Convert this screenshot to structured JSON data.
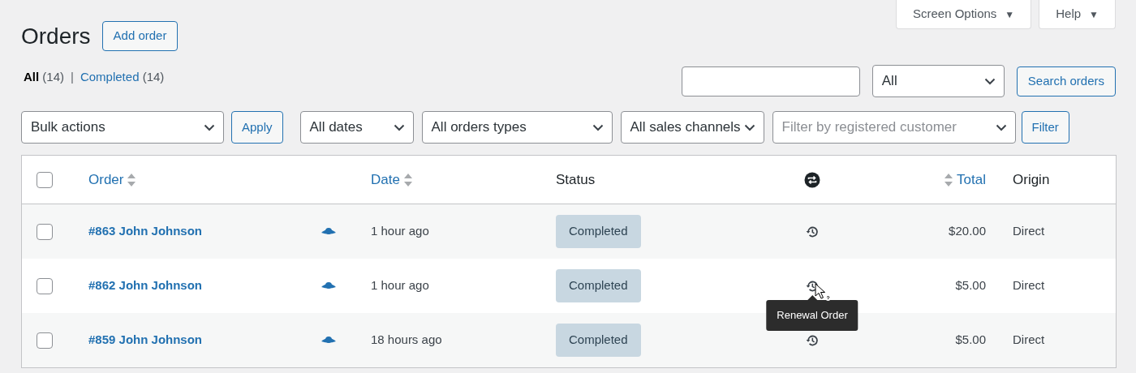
{
  "header_tabs": [
    {
      "label": "Screen Options",
      "caret": "▼"
    },
    {
      "label": "Help",
      "caret": "▼"
    }
  ],
  "title": "Orders",
  "add_button": "Add order",
  "views_separator": "|",
  "views": [
    {
      "label": "All",
      "count": "(14)",
      "selected": true
    },
    {
      "label": "Completed",
      "count": "(14)",
      "selected": false
    }
  ],
  "search": {
    "type": "All",
    "button": "Search orders"
  },
  "bulk_actions": {
    "value": "Bulk actions",
    "button": "Apply"
  },
  "filters": [
    {
      "value": "All dates"
    },
    {
      "value": "All orders types"
    },
    {
      "value": "All sales channels"
    },
    {
      "placeholder": "Filter by registered customer"
    }
  ],
  "filter_button": "Filter",
  "table": {
    "select_all": {
      "checked": false
    },
    "columns": [
      {
        "kind": "order",
        "label": "Order",
        "sortable": true
      },
      {
        "kind": "date",
        "label": "Date",
        "sortable": true
      },
      {
        "kind": "status",
        "label": "Status",
        "sortable": false
      },
      {
        "kind": "relationship"
      },
      {
        "kind": "total",
        "label": "Total",
        "sortable": true
      },
      {
        "kind": "origin",
        "label": "Origin",
        "sortable": false
      }
    ],
    "rows": [
      {
        "checked": false,
        "order": "#863 John Johnson",
        "date": "1 hour ago",
        "status": "Completed",
        "total": "$20.00",
        "origin": "Direct"
      },
      {
        "checked": false,
        "order": "#862 John Johnson",
        "date": "1 hour ago",
        "status": "Completed",
        "total": "$5.00",
        "origin": "Direct",
        "tooltip": "Renewal Order"
      },
      {
        "checked": false,
        "order": "#859 John Johnson",
        "date": "18 hours ago",
        "status": "Completed",
        "total": "$5.00",
        "origin": "Direct"
      }
    ]
  }
}
